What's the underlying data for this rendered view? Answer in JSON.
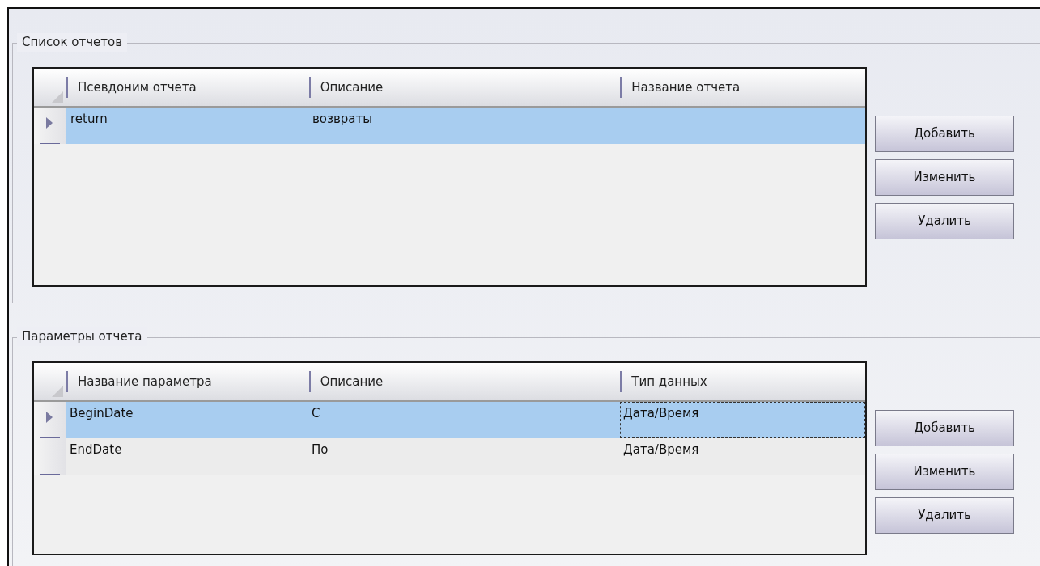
{
  "groups": [
    {
      "title": "Список отчетов",
      "columns": [
        "Псевдоним отчета",
        "Описание",
        "Название отчета"
      ],
      "rows": [
        {
          "selected": true,
          "cells": [
            {
              "text": "return",
              "focused": false
            },
            {
              "text": "возвраты",
              "focused": false
            }
          ]
        }
      ],
      "buttons": [
        "Добавить",
        "Изменить",
        "Удалить"
      ]
    },
    {
      "title": "Параметры отчета",
      "columns": [
        "Название параметра",
        "Описание",
        "Тип данных"
      ],
      "rows": [
        {
          "selected": true,
          "cells": [
            {
              "text": "BeginDate",
              "focused": false
            },
            {
              "text": "С",
              "focused": false
            },
            {
              "text": "Дата/Время",
              "focused": true
            }
          ]
        },
        {
          "selected": false,
          "cells": [
            {
              "text": "EndDate",
              "focused": false
            },
            {
              "text": "По",
              "focused": false
            },
            {
              "text": "Дата/Время",
              "focused": false
            }
          ]
        }
      ],
      "buttons": [
        "Добавить",
        "Изменить",
        "Удалить"
      ]
    }
  ]
}
